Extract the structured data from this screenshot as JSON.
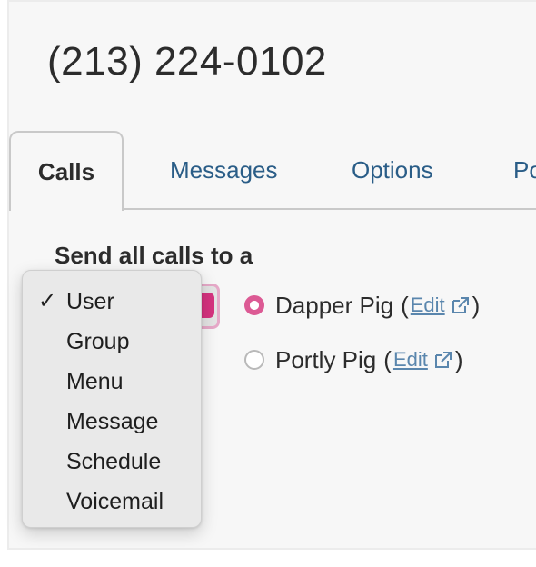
{
  "header": {
    "phone_number": "(213) 224-0102"
  },
  "tabs": [
    {
      "label": "Calls",
      "active": true
    },
    {
      "label": "Messages",
      "active": false
    },
    {
      "label": "Options",
      "active": false
    },
    {
      "label": "Po",
      "active": false
    }
  ],
  "calls": {
    "section_label": "Send all calls to a",
    "destination_type_selected": "User",
    "destination_type_options": [
      "User",
      "Group",
      "Menu",
      "Message",
      "Schedule",
      "Voicemail"
    ],
    "check_mark": "✓",
    "users": [
      {
        "name": "Dapper Pig",
        "selected": true,
        "open_paren": "(",
        "edit_label": "Edit",
        "close_paren": ")"
      },
      {
        "name": "Portly Pig",
        "selected": false,
        "open_paren": "(",
        "edit_label": "Edit",
        "close_paren": ")"
      }
    ]
  },
  "icons": {
    "external_link": "external-link-icon",
    "radio_checked": "radio-checked",
    "radio_unchecked": "radio-unchecked",
    "select_arrow": "select-arrow"
  },
  "colors": {
    "accent_pink": "#dc5a94",
    "focus_ring": "#e6a9c8",
    "link_blue": "#5a86ad",
    "tab_text_blue": "#2a5d87",
    "text_dark": "#2c2c2c",
    "panel_bg": "#f7f7f7",
    "menu_bg": "#e9e9e9"
  }
}
